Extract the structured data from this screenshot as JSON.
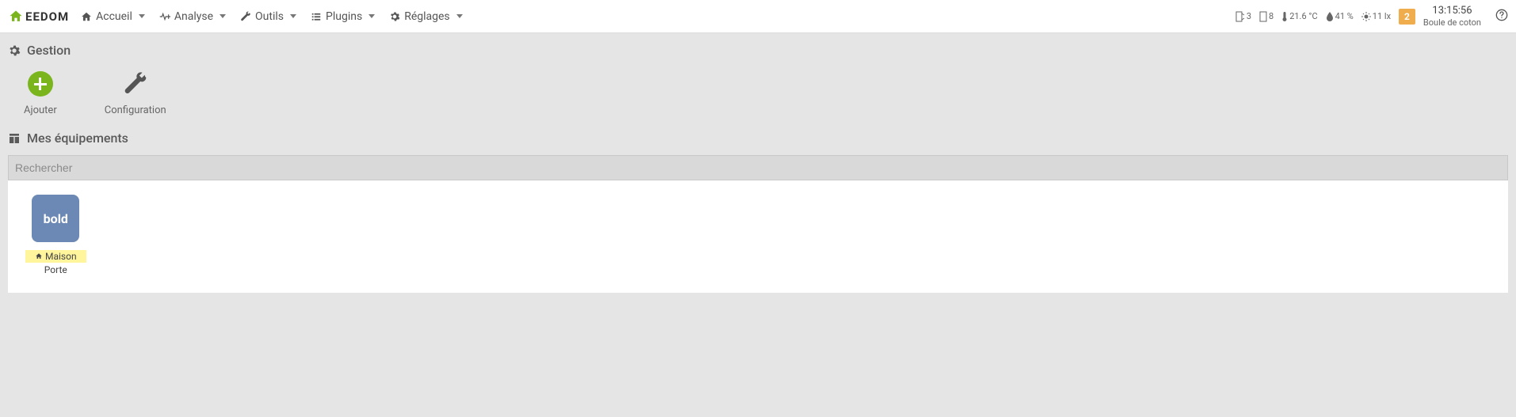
{
  "logo_text": "EEDOM",
  "nav": {
    "accueil": "Accueil",
    "analyse": "Analyse",
    "outils": "Outils",
    "plugins": "Plugins",
    "reglages": "Réglages"
  },
  "status": {
    "door1": "3",
    "door2": "8",
    "temp": "21.6 °C",
    "humidity": "41 %",
    "lux": "11 lx",
    "badge": "2",
    "time": "13:15:56",
    "label": "Boule de coton"
  },
  "sections": {
    "gestion": "Gestion",
    "equipements": "Mes équipements"
  },
  "actions": {
    "ajouter": "Ajouter",
    "configuration": "Configuration"
  },
  "search_placeholder": "Rechercher",
  "equipment": {
    "icon_text": "bold",
    "room": "Maison",
    "name": "Porte"
  }
}
